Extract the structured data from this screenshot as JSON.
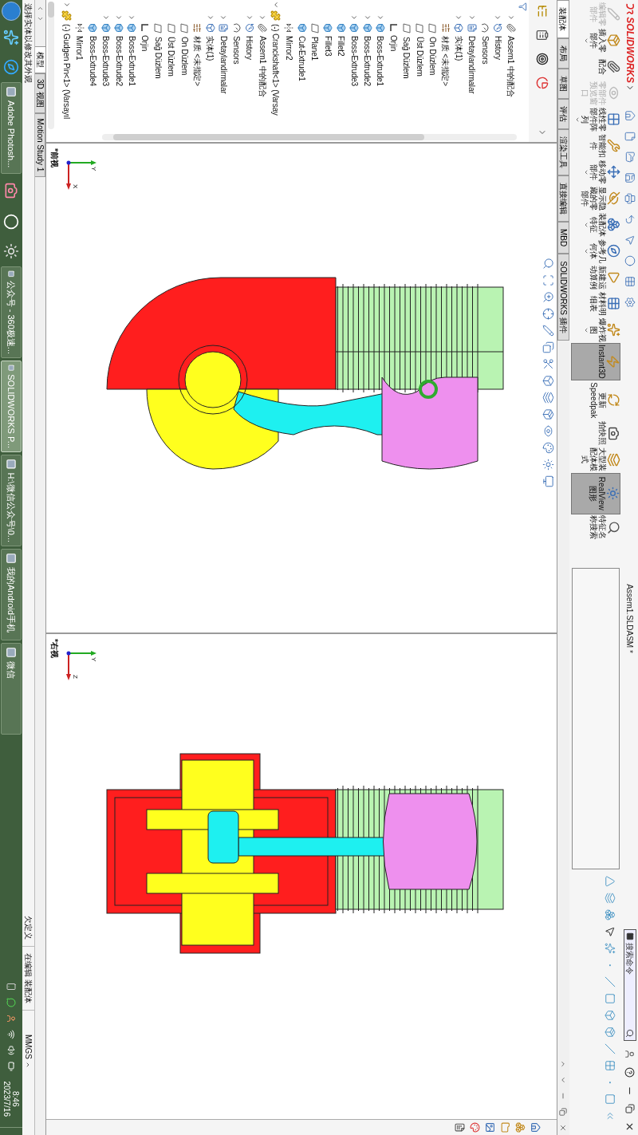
{
  "title_bar": {
    "logo": "SOLIDWORKS",
    "document": "Assem1.SLDASM *",
    "search": {
      "placeholder": "搜索命令"
    }
  },
  "ribbon": {
    "buttons": [
      {
        "label": "编辑零部件",
        "disabled": true,
        "selected": false,
        "dropdown": false
      },
      {
        "label": "插入零部件",
        "disabled": false,
        "selected": false,
        "dropdown": true
      },
      {
        "label": "配合",
        "disabled": false,
        "selected": false,
        "dropdown": false
      },
      {
        "label": "零部件预览窗口",
        "disabled": true,
        "selected": false,
        "dropdown": false
      },
      {
        "label": "线性零部件阵列",
        "disabled": false,
        "selected": false,
        "dropdown": true
      },
      {
        "label": "智能扣件",
        "disabled": false,
        "selected": false,
        "dropdown": false
      },
      {
        "label": "移动零部件",
        "disabled": false,
        "selected": false,
        "dropdown": true
      },
      {
        "label": "显示隐藏的零部件",
        "disabled": false,
        "selected": false,
        "dropdown": false
      },
      {
        "label": "装配体特征",
        "disabled": false,
        "selected": false,
        "dropdown": true
      },
      {
        "label": "参考几何体",
        "disabled": false,
        "selected": false,
        "dropdown": true
      },
      {
        "label": "新建运动算例",
        "disabled": false,
        "selected": false,
        "dropdown": false
      },
      {
        "label": "材料明细表",
        "disabled": false,
        "selected": false,
        "dropdown": false
      },
      {
        "label": "爆炸视图",
        "disabled": false,
        "selected": false,
        "dropdown": true
      },
      {
        "label": "Instant3D",
        "disabled": false,
        "selected": true,
        "dropdown": false
      },
      {
        "label": "更新Speedpak",
        "disabled": false,
        "selected": false,
        "dropdown": false
      },
      {
        "label": "拍快照",
        "disabled": false,
        "selected": false,
        "dropdown": false
      },
      {
        "label": "大型装配体模式",
        "disabled": false,
        "selected": false,
        "dropdown": false
      },
      {
        "label": "RealView图形",
        "disabled": false,
        "selected": true,
        "dropdown": false
      },
      {
        "label": "特征名称搜索",
        "disabled": false,
        "selected": false,
        "dropdown": false
      }
    ]
  },
  "command_tabs": [
    {
      "label": "装配体",
      "selected": true
    },
    {
      "label": "布局",
      "selected": false
    },
    {
      "label": "草图",
      "selected": false
    },
    {
      "label": "评估",
      "selected": false
    },
    {
      "label": "渲染工具",
      "selected": false
    },
    {
      "label": "直接编辑",
      "selected": false
    },
    {
      "label": "MBD",
      "selected": false
    },
    {
      "label": "SOLIDWORKS 插件",
      "selected": false
    }
  ],
  "feature_tree": {
    "items": [
      {
        "children": [
          {
            "label": "Assem1 中的配合",
            "kind": "mates",
            "expanded": false
          },
          {
            "label": "History",
            "kind": "history",
            "expanded": false
          },
          {
            "label": "Sensors",
            "kind": "sensors"
          },
          {
            "label": "Detaylandirmalar",
            "kind": "annotations",
            "expanded": false
          },
          {
            "label": "实体(1)",
            "kind": "bodies",
            "expanded": false
          },
          {
            "label": "材质 <未指定>",
            "kind": "material"
          },
          {
            "label": "On Düzlem",
            "kind": "plane"
          },
          {
            "label": "Üst Düzlem",
            "kind": "plane"
          },
          {
            "label": "Sağ Düzlem",
            "kind": "plane"
          },
          {
            "label": "Orjin",
            "kind": "origin"
          },
          {
            "label": "Boss-Extrude1",
            "kind": "feature",
            "expanded": false
          },
          {
            "label": "Boss-Extrude2",
            "kind": "feature",
            "expanded": false
          },
          {
            "label": "Boss-Extrude3",
            "kind": "feature",
            "expanded": false
          },
          {
            "label": "Fillet2",
            "kind": "feature"
          },
          {
            "label": "Fillet3",
            "kind": "feature"
          },
          {
            "label": "Plane1",
            "kind": "plane"
          },
          {
            "label": "Cut-Extrude1",
            "kind": "feature"
          },
          {
            "label": "Mirror2",
            "kind": "mirror"
          }
        ]
      },
      {
        "label": "(-) Cranckshaft<1> (Varsay",
        "kind": "component",
        "expanded": true,
        "children": [
          {
            "label": "Assem1 中的配合",
            "kind": "mates",
            "expanded": false
          },
          {
            "label": "History",
            "kind": "history",
            "expanded": false
          },
          {
            "label": "Sensors",
            "kind": "sensors"
          },
          {
            "label": "Detaylandirmalar",
            "kind": "annotations",
            "expanded": false
          },
          {
            "label": "实体(1)",
            "kind": "bodies",
            "expanded": false
          },
          {
            "label": "材质 <未指定>",
            "kind": "material"
          },
          {
            "label": "On Düzlem",
            "kind": "plane"
          },
          {
            "label": "Üst Düzlem",
            "kind": "plane"
          },
          {
            "label": "Sağ Düzlem",
            "kind": "plane"
          },
          {
            "label": "Orjin",
            "kind": "origin"
          },
          {
            "label": "Boss-Extrude1",
            "kind": "feature",
            "expanded": false
          },
          {
            "label": "Boss-Extrude2",
            "kind": "feature",
            "expanded": false
          },
          {
            "label": "Boss-Extrude3",
            "kind": "feature",
            "expanded": false
          },
          {
            "label": "Boss-Extrude4",
            "kind": "feature"
          },
          {
            "label": "Mirror1",
            "kind": "mirror"
          }
        ]
      },
      {
        "label": "(-) Gudgen Pin<1> (Varsayıl",
        "kind": "component",
        "expanded": false
      }
    ]
  },
  "viewports": [
    {
      "kind": "front",
      "label": "*前视",
      "axes": [
        "Y",
        "X"
      ]
    },
    {
      "kind": "right",
      "label": "*右视",
      "axes": [
        "Y",
        "Z"
      ]
    }
  ],
  "model_tabs": [
    {
      "label": "模型",
      "selected": true
    },
    {
      "label": "3D 视图",
      "selected": false
    },
    {
      "label": "Motion Study 1",
      "selected": false
    }
  ],
  "status_bar": {
    "message": "选择实体以修改其外观",
    "state": "欠定义",
    "mode": "在编辑 装配体",
    "units": "MMGS"
  },
  "taskbar": {
    "apps": [
      {
        "label": "Adobe Photosh...",
        "selected": false
      },
      {
        "label": "公众号 - 360极速...",
        "selected": false
      },
      {
        "label": "SOLIDWORKS P...",
        "selected": true
      },
      {
        "label": "H:\\微信公众号\\0...",
        "selected": false
      },
      {
        "label": "我的Android手机",
        "selected": false
      },
      {
        "label": "微信",
        "selected": false
      }
    ],
    "time": "8:46",
    "date": "2023/7/16"
  }
}
